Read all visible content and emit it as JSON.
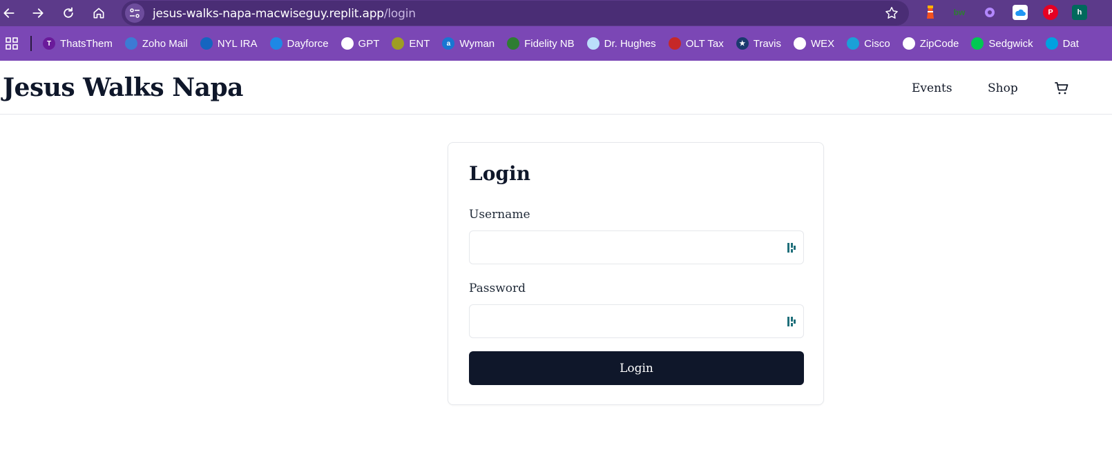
{
  "browser": {
    "url_host": "jesus-walks-napa-macwiseguy.replit.app",
    "url_path": "/login",
    "bookmarks": [
      {
        "label": "ThatsThem",
        "icon": "thatsthem-icon",
        "color": "#6a1b9a",
        "glyph": "T"
      },
      {
        "label": "Zoho Mail",
        "icon": "zoho-mail-icon",
        "color": "#3c7bd4",
        "glyph": ""
      },
      {
        "label": "NYL IRA",
        "icon": "nyl-icon",
        "color": "#1565c0",
        "glyph": ""
      },
      {
        "label": "Dayforce",
        "icon": "dayforce-icon",
        "color": "#1e88e5",
        "glyph": ""
      },
      {
        "label": "GPT",
        "icon": "openai-icon",
        "color": "#ffffff",
        "glyph": ""
      },
      {
        "label": "ENT",
        "icon": "ent-icon",
        "color": "#9e9d24",
        "glyph": ""
      },
      {
        "label": "Wyman",
        "icon": "wyman-icon",
        "color": "#1976d2",
        "glyph": "a"
      },
      {
        "label": "Fidelity NB",
        "icon": "fidelity-icon",
        "color": "#2e7d32",
        "glyph": ""
      },
      {
        "label": "Dr. Hughes",
        "icon": "document-icon",
        "color": "#bbdefb",
        "glyph": ""
      },
      {
        "label": "OLT Tax",
        "icon": "olt-icon",
        "color": "#c62828",
        "glyph": ""
      },
      {
        "label": "Travis",
        "icon": "travis-icon",
        "color": "#1a3a6e",
        "glyph": "★"
      },
      {
        "label": "WEX",
        "icon": "globe-icon",
        "color": "#ffffff",
        "glyph": ""
      },
      {
        "label": "Cisco",
        "icon": "cisco-icon",
        "color": "#1ba0d7",
        "glyph": ""
      },
      {
        "label": "ZipCode",
        "icon": "globe-icon",
        "color": "#ffffff",
        "glyph": ""
      },
      {
        "label": "Sedgwick",
        "icon": "sedgwick-icon",
        "color": "#00c853",
        "glyph": ""
      },
      {
        "label": "Dat",
        "icon": "salesforce-icon",
        "color": "#00a1e0",
        "glyph": ""
      }
    ]
  },
  "site": {
    "brand": "Jesus Walks Napa",
    "nav": {
      "events": "Events",
      "shop": "Shop"
    }
  },
  "login": {
    "title": "Login",
    "username_label": "Username",
    "username_value": "",
    "password_label": "Password",
    "password_value": "",
    "submit_label": "Login"
  },
  "colors": {
    "browser_bar": "#5c3a8a",
    "bookmarks_bar": "#7b47b5",
    "primary_button": "#0f172a"
  }
}
